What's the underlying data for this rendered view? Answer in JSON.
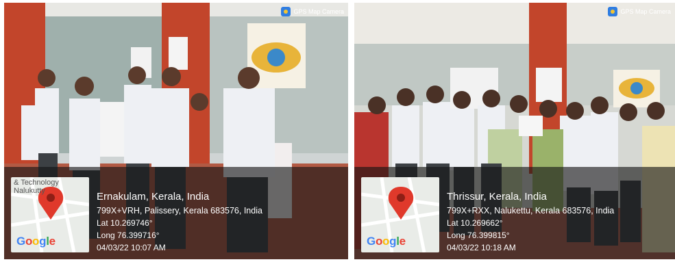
{
  "colors": {
    "wall_red": "#c2452b",
    "overlay": "#141414",
    "map_pin": "#e0392b",
    "gps_icon": "#2f7de1"
  },
  "icons": [
    "map-pin-icon",
    "gps-map-camera-icon"
  ],
  "photos": [
    {
      "gps_label": "GPS Map Camera",
      "map_text": "& Technology Nalukutty",
      "map_logo": "Google",
      "city": "Ernakulam, Kerala, India",
      "address": "799X+VRH, Palissery, Kerala 683576, India",
      "lat": "Lat 10.269746°",
      "long": "Long 76.399716°",
      "datetime": "04/03/22 10:07 AM"
    },
    {
      "gps_label": "GPS Map Camera",
      "map_text": "",
      "map_logo": "Google",
      "city": "Thrissur, Kerala, India",
      "address": "799X+RXX, Nalukettu, Kerala 683576, India",
      "lat": "Lat 10.269662°",
      "long": "Long 76.399815°",
      "datetime": "04/03/22 10:18 AM"
    }
  ]
}
